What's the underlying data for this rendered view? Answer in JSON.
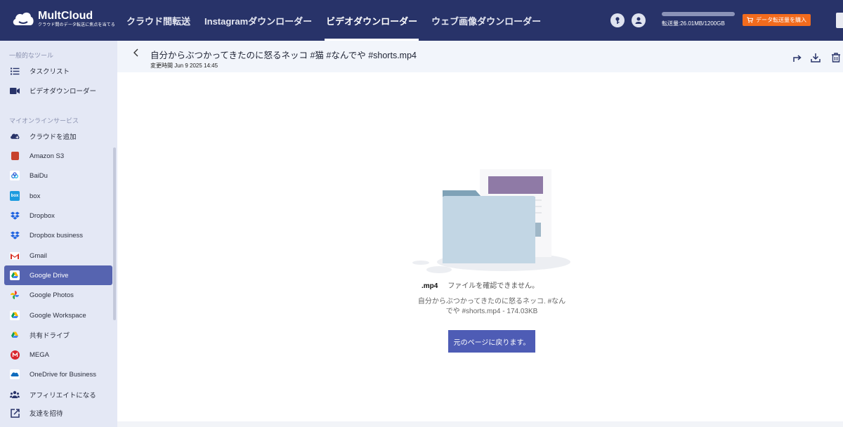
{
  "brand": {
    "name": "MultCloud",
    "tagline": "クラウド間のデータ転送に焦点を当てる"
  },
  "nav": {
    "items": [
      {
        "label": "クラウド間転送",
        "active": false
      },
      {
        "label": "Instagramダウンローダー",
        "active": false
      },
      {
        "label": "ビデオダウンローダー",
        "active": true
      },
      {
        "label": "ウェブ画像ダウンローダー",
        "active": false
      }
    ]
  },
  "header": {
    "usage_text": "転送量:26.01MB/1200GB",
    "buy_label": "データ転送量を購入",
    "icons": [
      "key-icon",
      "user-icon"
    ]
  },
  "sidebar": {
    "section_tools": "一般的なツール",
    "tools": [
      {
        "label": "タスクリスト",
        "icon": "list-icon"
      },
      {
        "label": "ビデオダウンローダー",
        "icon": "video-icon"
      }
    ],
    "section_services": "マイオンラインサービス",
    "services": [
      {
        "label": "クラウドを追加",
        "icon": "add-cloud-icon",
        "active": false
      },
      {
        "label": "Amazon S3",
        "icon": "amazon-s3-icon",
        "active": false
      },
      {
        "label": "BaiDu",
        "icon": "baidu-icon",
        "active": false
      },
      {
        "label": "box",
        "icon": "box-icon",
        "active": false
      },
      {
        "label": "Dropbox",
        "icon": "dropbox-icon",
        "active": false
      },
      {
        "label": "Dropbox business",
        "icon": "dropbox-business-icon",
        "active": false
      },
      {
        "label": "Gmail",
        "icon": "gmail-icon",
        "active": false
      },
      {
        "label": "Google Drive",
        "icon": "google-drive-icon",
        "active": true
      },
      {
        "label": "Google Photos",
        "icon": "google-photos-icon",
        "active": false
      },
      {
        "label": "Google Workspace",
        "icon": "google-workspace-icon",
        "active": false
      },
      {
        "label": "共有ドライブ",
        "icon": "shared-drive-icon",
        "active": false
      },
      {
        "label": "MEGA",
        "icon": "mega-icon",
        "active": false
      },
      {
        "label": "OneDrive for Business",
        "icon": "onedrive-business-icon",
        "active": false
      },
      {
        "label": "アフィリエイトになる",
        "icon": "affiliate-icon",
        "active": false
      },
      {
        "label": "友達を招待",
        "icon": "invite-icon",
        "active": false
      }
    ]
  },
  "file": {
    "title": "自分からぶつかってきたのに怒るネッコ #猫 #なんでや #shorts.mp4",
    "meta": "変更時間 Jun 9 2025 14:45",
    "actions": [
      "share-icon",
      "download-icon",
      "delete-icon"
    ]
  },
  "preview": {
    "ext": ".mp4",
    "message": "ファイルを確認できません。",
    "desc_line1": "自分からぶつかってきたのに怒るネッコ. #なん",
    "desc_line2": "でや #shorts.mp4 - 174.03KB",
    "return_label": "元のページに戻ります。"
  },
  "colors": {
    "topbar": "#283369",
    "accent": "#5664b0",
    "button": "#4e5cb5",
    "buy": "#f26b1d",
    "sidebar_bg": "#e4e8f5"
  }
}
